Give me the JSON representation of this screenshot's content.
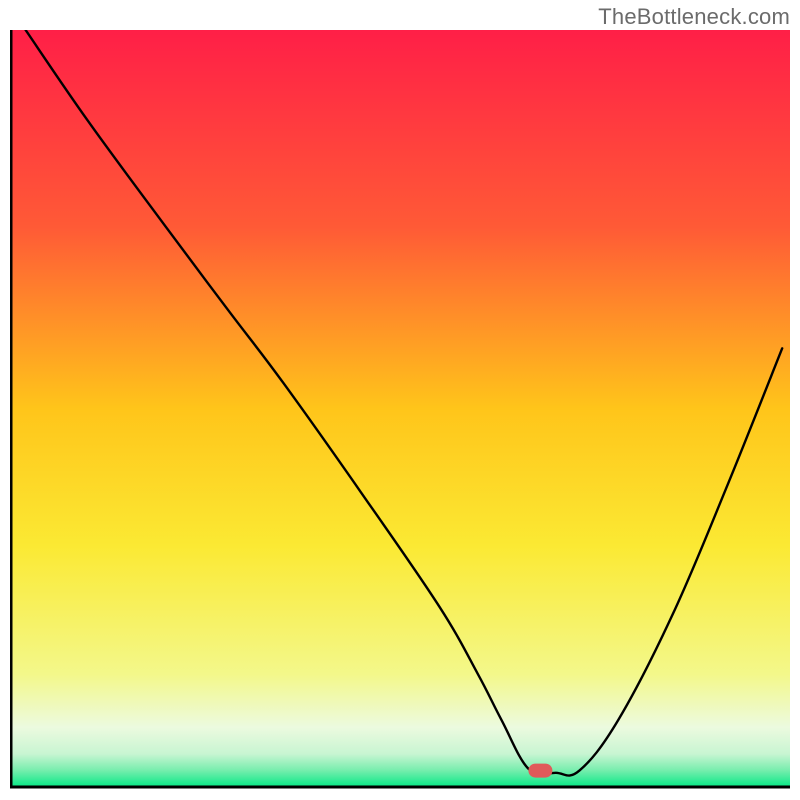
{
  "watermark": "TheBottleneck.com",
  "chart_data": {
    "type": "line",
    "title": "",
    "xlabel": "",
    "ylabel": "",
    "xlim": [
      0,
      100
    ],
    "ylim": [
      0,
      100
    ],
    "grid": false,
    "legend": false,
    "annotations": [],
    "series": [
      {
        "name": "curve",
        "x": [
          2,
          10,
          20,
          28,
          35,
          45,
          55,
          60,
          63,
          66.5,
          70,
          73,
          78,
          85,
          92,
          99
        ],
        "values": [
          100,
          88,
          74,
          63,
          53.5,
          39,
          24,
          15,
          9,
          2.5,
          2,
          2.3,
          9,
          23,
          40,
          58
        ]
      }
    ],
    "marker": {
      "x": 68,
      "y": 2.3
    },
    "colors": {
      "gradient_top": "#ff1f47",
      "gradient_mid1": "#ff7a30",
      "gradient_mid2": "#ffc51a",
      "gradient_mid3": "#fbe933",
      "gradient_mid4": "#f7fca9",
      "gradient_bottom": "#00e884",
      "curve": "#000000",
      "marker": "#e05a5a",
      "axis": "#000000"
    }
  }
}
